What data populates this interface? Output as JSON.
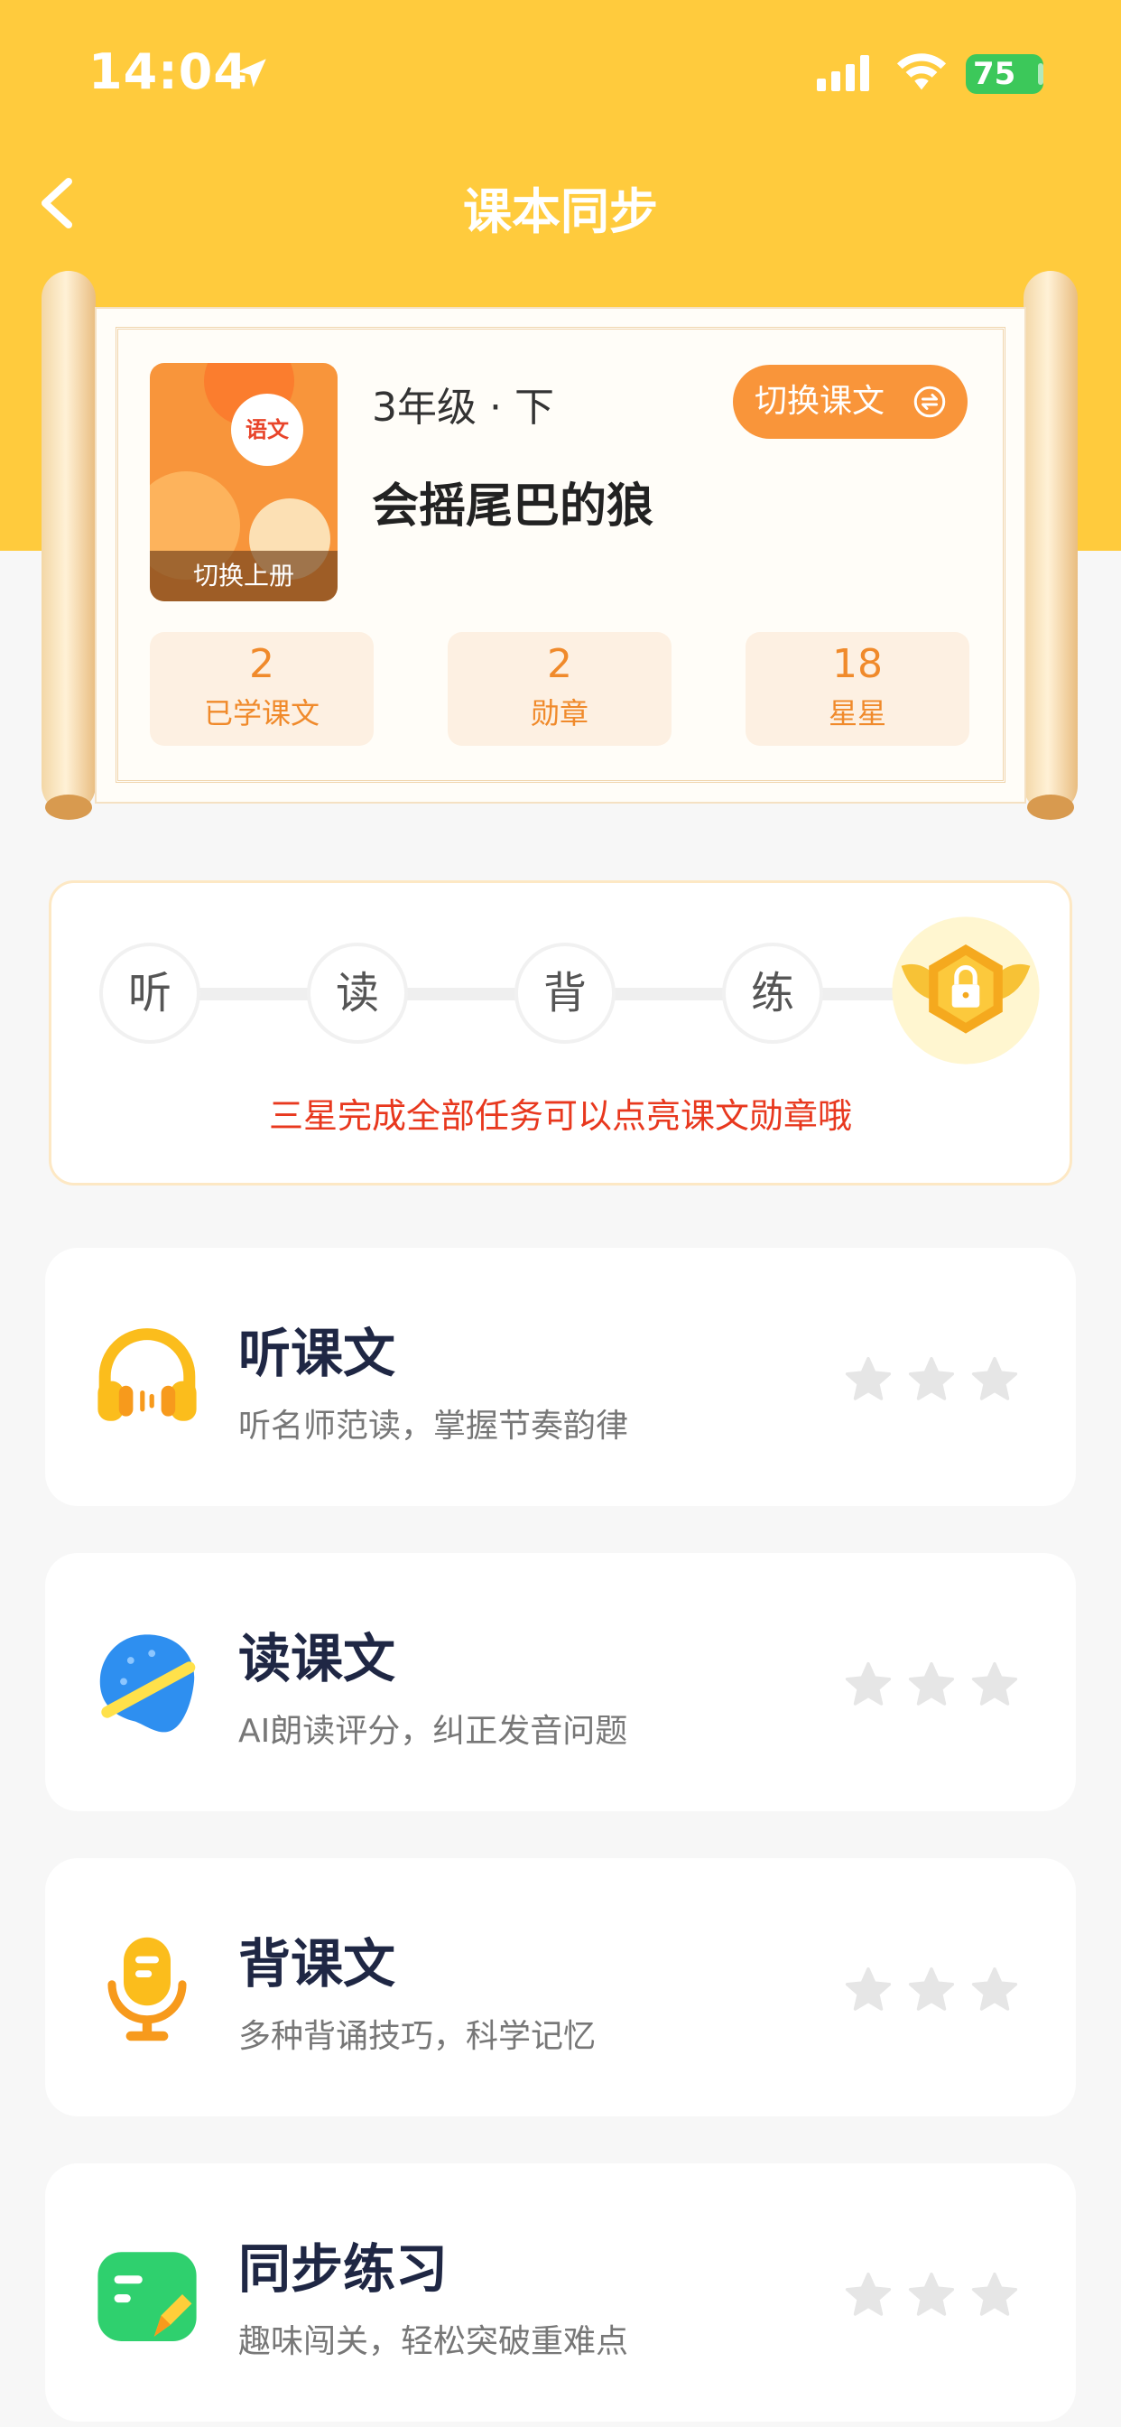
{
  "status_bar": {
    "time": "14:04",
    "battery": "75"
  },
  "nav": {
    "title": "课本同步"
  },
  "book": {
    "cover_badge": "语文",
    "cover_switch_label": "切换上册",
    "grade": "3年级 · 下",
    "lesson_title": "会摇尾巴的狼",
    "switch_label": "切换课文"
  },
  "stats": [
    {
      "value": "2",
      "label": "已学课文"
    },
    {
      "value": "2",
      "label": "勋章"
    },
    {
      "value": "18",
      "label": "星星"
    }
  ],
  "progress": {
    "steps": [
      "听",
      "读",
      "背",
      "练"
    ],
    "tip": "三星完成全部任务可以点亮课文勋章哦"
  },
  "tasks": [
    {
      "title": "听课文",
      "subtitle": "听名师范读，掌握节奏韵律",
      "icon": "headphones-icon",
      "stars": 0
    },
    {
      "title": "读课文",
      "subtitle": "AI朗读评分，纠正发音问题",
      "icon": "read-bubble-icon",
      "stars": 0
    },
    {
      "title": "背课文",
      "subtitle": "多种背诵技巧，科学记忆",
      "icon": "microphone-icon",
      "stars": 0
    },
    {
      "title": "同步练习",
      "subtitle": "趣味闯关，轻松突破重难点",
      "icon": "practice-pencil-icon",
      "stars": 0
    }
  ],
  "colors": {
    "header": "#ffcb3d",
    "accent": "#f9953a",
    "tip": "#e8381e"
  }
}
